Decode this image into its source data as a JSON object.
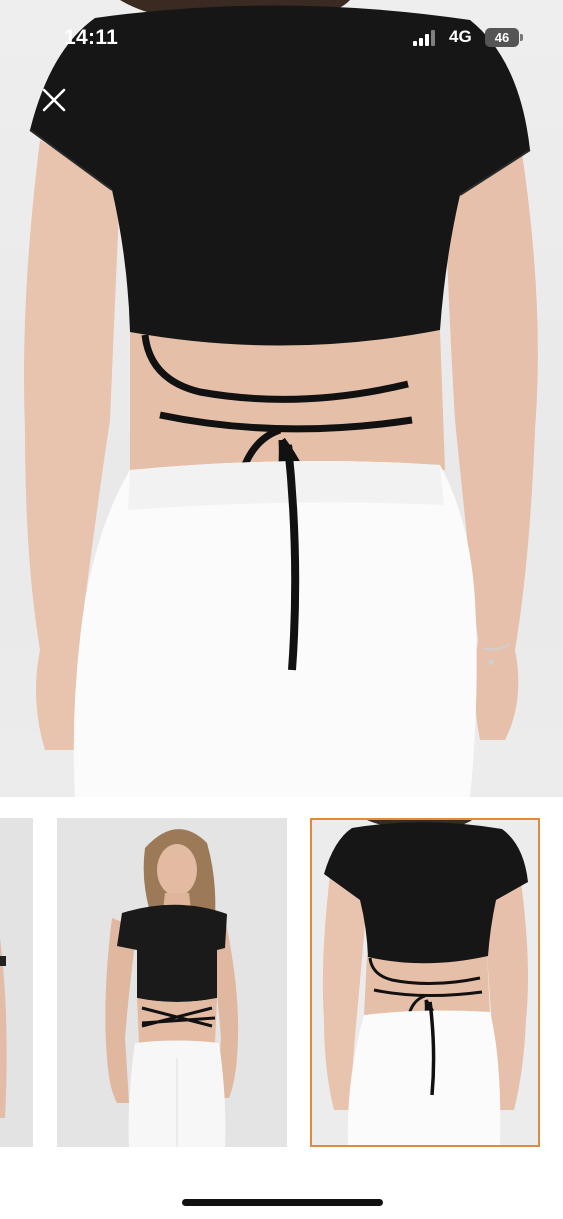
{
  "status_bar": {
    "time": "14:11",
    "network": "4G",
    "battery": "46"
  },
  "close_button": {
    "icon": "close-icon"
  },
  "gallery": {
    "thumbnails": [
      {
        "name": "thumbnail-partial",
        "selected": false
      },
      {
        "name": "thumbnail-front-view",
        "selected": false
      },
      {
        "name": "thumbnail-back-view",
        "selected": true
      }
    ],
    "selected_border_color": "#e08a3c"
  }
}
